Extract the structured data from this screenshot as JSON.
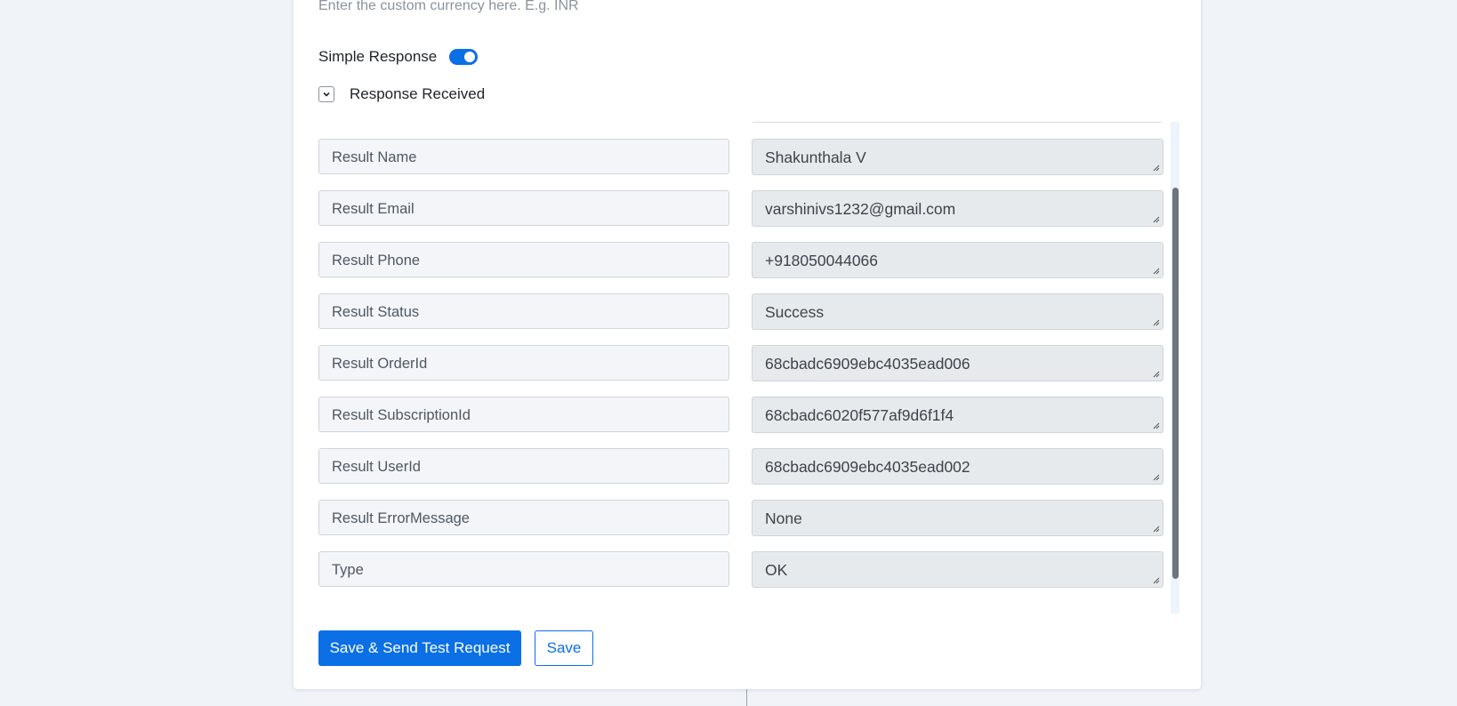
{
  "currency_hint": "Enter the custom currency here. E.g. INR",
  "simple_response": {
    "label": "Simple Response",
    "enabled": true
  },
  "response_section": {
    "label": "Response Received",
    "expanded": true
  },
  "rows": [
    {
      "key": "Result Name",
      "value": "Shakunthala V"
    },
    {
      "key": "Result Email",
      "value": "varshinivs1232@gmail.com"
    },
    {
      "key": "Result Phone",
      "value": "+918050044066"
    },
    {
      "key": "Result Status",
      "value": "Success"
    },
    {
      "key": "Result OrderId",
      "value": "68cbadc6909ebc4035ead006"
    },
    {
      "key": "Result SubscriptionId",
      "value": "68cbadc6020f577af9d6f1f4"
    },
    {
      "key": "Result UserId",
      "value": "68cbadc6909ebc4035ead002"
    },
    {
      "key": "Result ErrorMessage",
      "value": "None"
    },
    {
      "key": "Type",
      "value": "OK"
    }
  ],
  "buttons": {
    "primary": "Save & Send Test Request",
    "secondary": "Save"
  },
  "colors": {
    "accent": "#0b6fe6",
    "page_bg": "#f0f4f8"
  }
}
